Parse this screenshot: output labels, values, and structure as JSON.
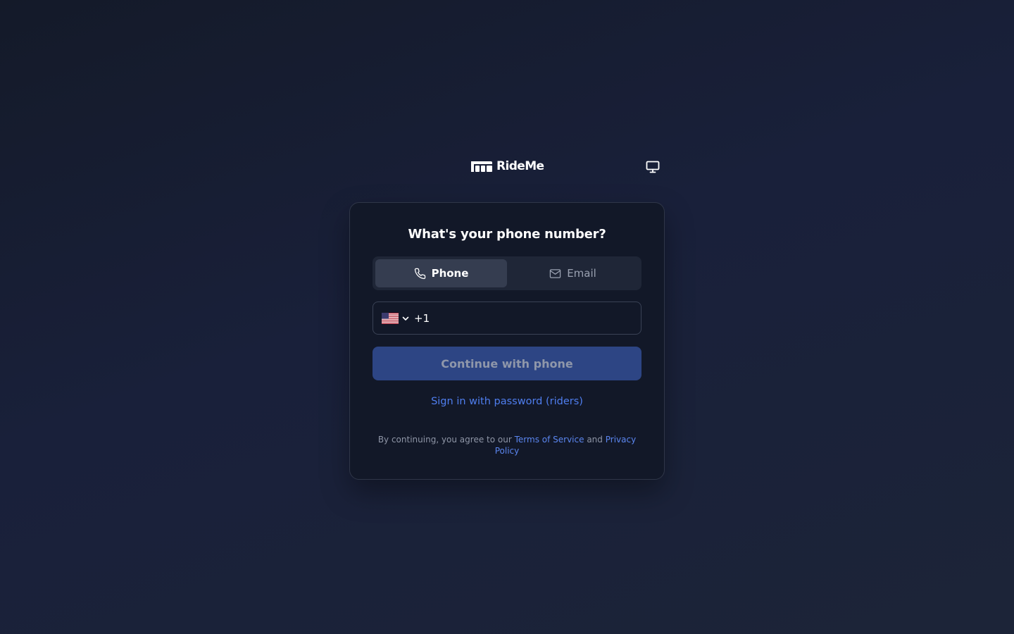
{
  "brand": {
    "name": "RideMe",
    "logo_icon": "rideme-logo-icon"
  },
  "header": {
    "display_icon": "monitor-icon"
  },
  "card": {
    "title": "What's your phone number?",
    "tabs": [
      {
        "label": "Phone",
        "icon": "phone-icon",
        "active": true
      },
      {
        "label": "Email",
        "icon": "mail-icon",
        "active": false
      }
    ],
    "phone": {
      "country_flag": "us-flag-icon",
      "dial_code": "+1",
      "value": "",
      "placeholder": ""
    },
    "continue_label": "Continue with phone",
    "password_link": "Sign in with password (riders)",
    "legal": {
      "prefix": "By continuing, you agree to our",
      "terms": "Terms of Service",
      "conjunction": "and",
      "privacy": "Privacy Policy"
    }
  },
  "colors": {
    "background": "#171d2e",
    "card": "#121828",
    "active_tab": "#353d50",
    "button": "#2d4584",
    "link": "#4f7eef"
  }
}
